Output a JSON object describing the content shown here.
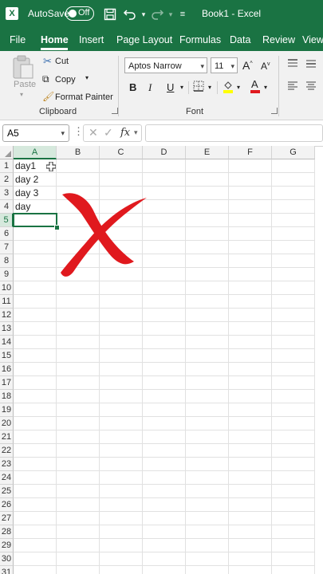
{
  "titlebar": {
    "autosave_label": "AutoSave",
    "autosave_state": "Off",
    "doc_title": "Book1  -  Excel",
    "icons": [
      "excel-logo",
      "save-icon",
      "undo-icon",
      "redo-icon",
      "customize-icon"
    ]
  },
  "tabs": [
    "File",
    "Home",
    "Insert",
    "Page Layout",
    "Formulas",
    "Data",
    "Review",
    "View"
  ],
  "active_tab": "Home",
  "ribbon": {
    "clipboard": {
      "paste": "Paste",
      "cut": "Cut",
      "copy": "Copy",
      "format_painter": "Format Painter",
      "label": "Clipboard"
    },
    "font": {
      "font_name": "Aptos Narrow",
      "font_size": "11",
      "bold": "B",
      "italic": "I",
      "underline": "U",
      "grow": "A",
      "shrink": "A",
      "label": "Font",
      "highlight_color": "#ffff00",
      "font_color": "#e0191e"
    }
  },
  "formula_bar": {
    "name_box": "A5",
    "fx": "fx",
    "formula": ""
  },
  "grid": {
    "columns": [
      "A",
      "B",
      "C",
      "D",
      "E",
      "F",
      "G"
    ],
    "rows": [
      "1",
      "2",
      "3",
      "4",
      "5",
      "6",
      "7",
      "8",
      "9",
      "10",
      "11",
      "12",
      "13",
      "14",
      "15",
      "16",
      "17",
      "18",
      "19",
      "20",
      "21",
      "22",
      "23",
      "24",
      "25",
      "26",
      "27",
      "28",
      "29",
      "30",
      "31"
    ],
    "selected_column": "A",
    "selected_row": "5",
    "cells": {
      "A1": "day1",
      "A2": "day 2",
      "A3": "day 3",
      "A4": "day"
    }
  },
  "colors": {
    "excel_green": "#1a7343",
    "red_x": "#e0191e"
  }
}
